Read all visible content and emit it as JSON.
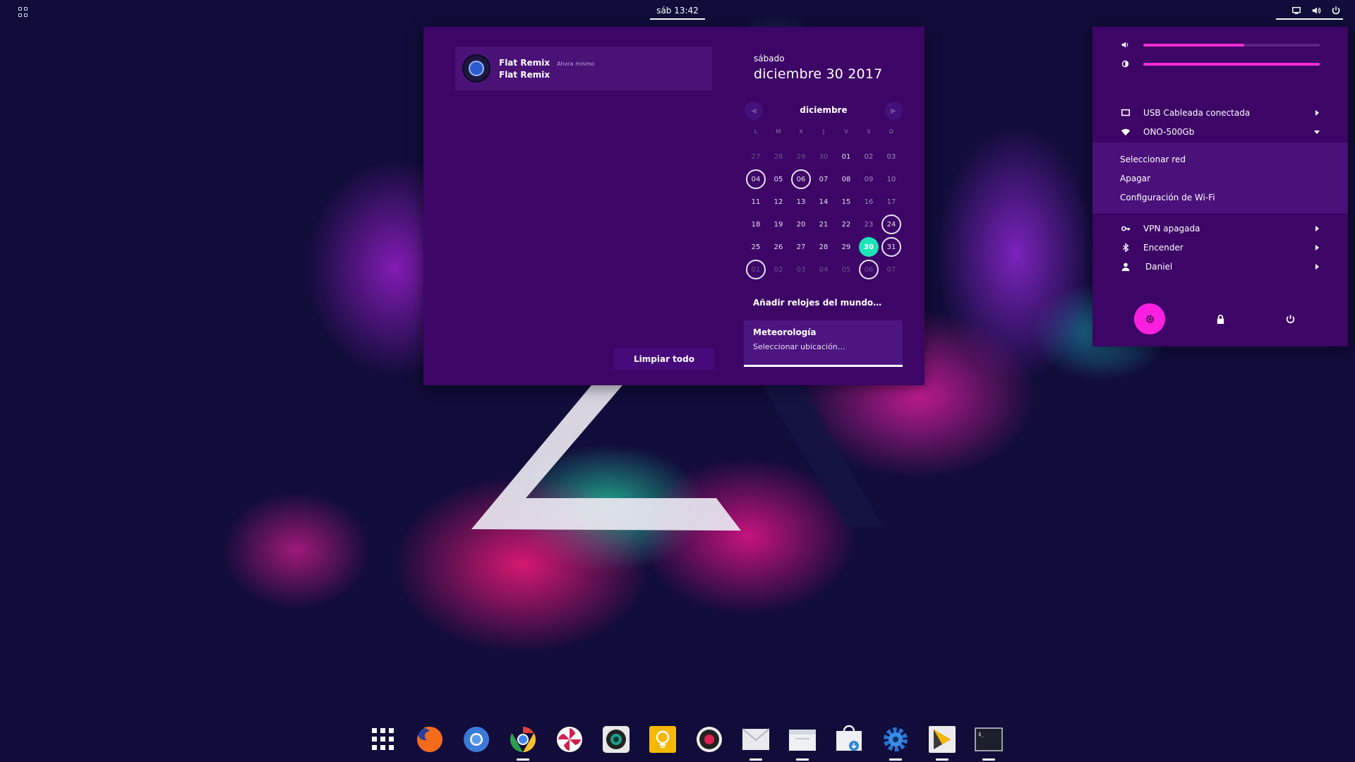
{
  "topbar": {
    "activities_icon": "grid-icon",
    "clock": "sáb 13:42",
    "tray_icons": [
      "display-icon",
      "volume-icon",
      "power-icon"
    ]
  },
  "notifications": {
    "items": [
      {
        "title": "Flat Remix",
        "time": "Ahora mismo",
        "body": "Flat Remix",
        "icon": "camera-app-icon"
      }
    ],
    "clear_label": "Limpiar todo"
  },
  "date": {
    "weekday": "sábado",
    "full": "diciembre 30 2017"
  },
  "calendar": {
    "month": "diciembre",
    "prev_icon": "chevron-left-icon",
    "next_icon": "chevron-right-icon",
    "weekdays": [
      "L",
      "M",
      "X",
      "J",
      "V",
      "S",
      "D"
    ],
    "weeks": [
      [
        {
          "d": "27",
          "o": true
        },
        {
          "d": "28",
          "o": true
        },
        {
          "d": "29",
          "o": true
        },
        {
          "d": "30",
          "o": true
        },
        {
          "d": "01"
        },
        {
          "d": "02",
          "w": true
        },
        {
          "d": "03",
          "w": true
        }
      ],
      [
        {
          "d": "04",
          "e": true
        },
        {
          "d": "05"
        },
        {
          "d": "06",
          "e": true
        },
        {
          "d": "07"
        },
        {
          "d": "08"
        },
        {
          "d": "09",
          "w": true
        },
        {
          "d": "10",
          "w": true
        }
      ],
      [
        {
          "d": "11"
        },
        {
          "d": "12"
        },
        {
          "d": "13"
        },
        {
          "d": "14"
        },
        {
          "d": "15"
        },
        {
          "d": "16",
          "w": true
        },
        {
          "d": "17",
          "w": true
        }
      ],
      [
        {
          "d": "18"
        },
        {
          "d": "19"
        },
        {
          "d": "20"
        },
        {
          "d": "21"
        },
        {
          "d": "22"
        },
        {
          "d": "23",
          "w": true
        },
        {
          "d": "24",
          "e": true
        }
      ],
      [
        {
          "d": "25"
        },
        {
          "d": "26"
        },
        {
          "d": "27"
        },
        {
          "d": "28"
        },
        {
          "d": "29"
        },
        {
          "d": "30",
          "t": true
        },
        {
          "d": "31",
          "e": true
        }
      ],
      [
        {
          "d": "01",
          "o": true,
          "e": true
        },
        {
          "d": "02",
          "o": true
        },
        {
          "d": "03",
          "o": true
        },
        {
          "d": "04",
          "o": true
        },
        {
          "d": "05",
          "o": true
        },
        {
          "d": "06",
          "o": true,
          "e": true
        },
        {
          "d": "07",
          "o": true
        }
      ]
    ]
  },
  "world_clocks_label": "Añadir relojes del mundo…",
  "weather": {
    "title": "Meteorología",
    "subtitle": "Seleccionar ubicación…"
  },
  "system_menu": {
    "volume_level": 0.57,
    "brightness_level": 1.0,
    "rows": {
      "wired": "USB Cableada conectada",
      "wifi": "ONO-500Gb",
      "vpn": "VPN apagada",
      "bluetooth": "Encender",
      "user": "Daniel"
    },
    "wifi_submenu": [
      "Seleccionar red",
      "Apagar",
      "Configuración de Wi-Fi"
    ],
    "buttons": [
      "settings-icon",
      "lock-icon",
      "power-icon"
    ]
  },
  "dock": {
    "apps": [
      {
        "name": "app-grid-icon",
        "running": false
      },
      {
        "name": "firefox-icon",
        "running": false
      },
      {
        "name": "chromium-icon",
        "running": false
      },
      {
        "name": "chrome-icon",
        "running": true
      },
      {
        "name": "pinwheel-app-icon",
        "running": false
      },
      {
        "name": "camera-app-icon",
        "running": false
      },
      {
        "name": "ideas-bulb-icon",
        "running": false
      },
      {
        "name": "screen-recorder-icon",
        "running": false
      },
      {
        "name": "mail-icon",
        "running": true
      },
      {
        "name": "files-icon",
        "running": true
      },
      {
        "name": "software-store-icon",
        "running": false
      },
      {
        "name": "settings-gear-icon",
        "running": true
      },
      {
        "name": "code-editor-icon",
        "running": true
      },
      {
        "name": "terminal-icon",
        "running": true
      }
    ]
  },
  "colors": {
    "panel": "#3c0566",
    "accent_today": "#1de4b6",
    "slider": "#ff2bd4",
    "settings_button": "#ff1fe0"
  }
}
